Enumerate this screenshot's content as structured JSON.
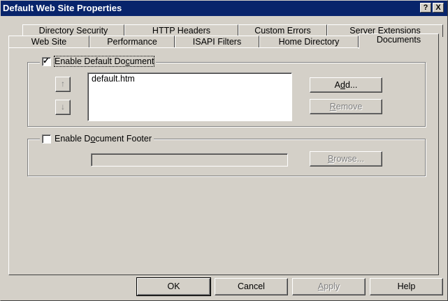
{
  "window": {
    "title": "Default Web Site Properties",
    "help_button": "?",
    "close_button": "X"
  },
  "tabs": {
    "row1": [
      "Directory Security",
      "HTTP Headers",
      "Custom Errors",
      "Server Extensions"
    ],
    "row2": [
      "Web Site",
      "Performance",
      "ISAPI Filters",
      "Home Directory",
      "Documents"
    ],
    "active": "Documents"
  },
  "default_doc": {
    "label_pre": "Enable Default Do",
    "label_ul": "c",
    "label_post": "ument",
    "checked": true,
    "check_glyph": "✓",
    "list_items": [
      "default.htm"
    ],
    "up_icon": "arrow-up-icon",
    "down_icon": "arrow-down-icon",
    "add_pre": "A",
    "add_ul": "d",
    "add_post": "d...",
    "remove_ul": "R",
    "remove_post": "emove"
  },
  "footer": {
    "label_pre": "Enable D",
    "label_ul": "o",
    "label_post": "cument Footer",
    "checked": false,
    "path_value": "",
    "browse_ul": "B",
    "browse_post": "rowse..."
  },
  "buttons": {
    "ok": "OK",
    "cancel": "Cancel",
    "apply_ul": "A",
    "apply_post": "pply",
    "help": "Help"
  },
  "colors": {
    "titlebar": "#08246b",
    "face": "#d4d0c8"
  }
}
